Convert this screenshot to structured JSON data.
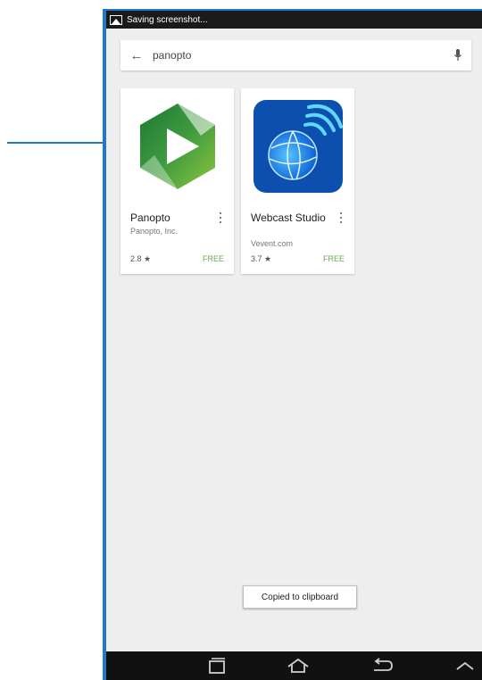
{
  "status_bar": {
    "text": "Saving screenshot..."
  },
  "search": {
    "query": "panopto"
  },
  "results": [
    {
      "title": "Panopto",
      "developer": "Panopto, Inc.",
      "rating": "2.8 ★",
      "price": "FREE"
    },
    {
      "title": "Webcast Studio",
      "developer": "Vevent.com",
      "rating": "3.7 ★",
      "price": "FREE"
    }
  ],
  "toast": {
    "text": "Copied to clipboard"
  },
  "colors": {
    "accent_blue": "#1f7bc9",
    "free_green": "#69a84f",
    "panopto_green": "#3f9a3f",
    "webcast_blue": "#0c4fae"
  },
  "icons": [
    "image-icon",
    "back-arrow-icon",
    "microphone-icon",
    "more-options-icon",
    "recent-apps-icon",
    "home-icon",
    "back-icon",
    "chevron-up-icon"
  ]
}
